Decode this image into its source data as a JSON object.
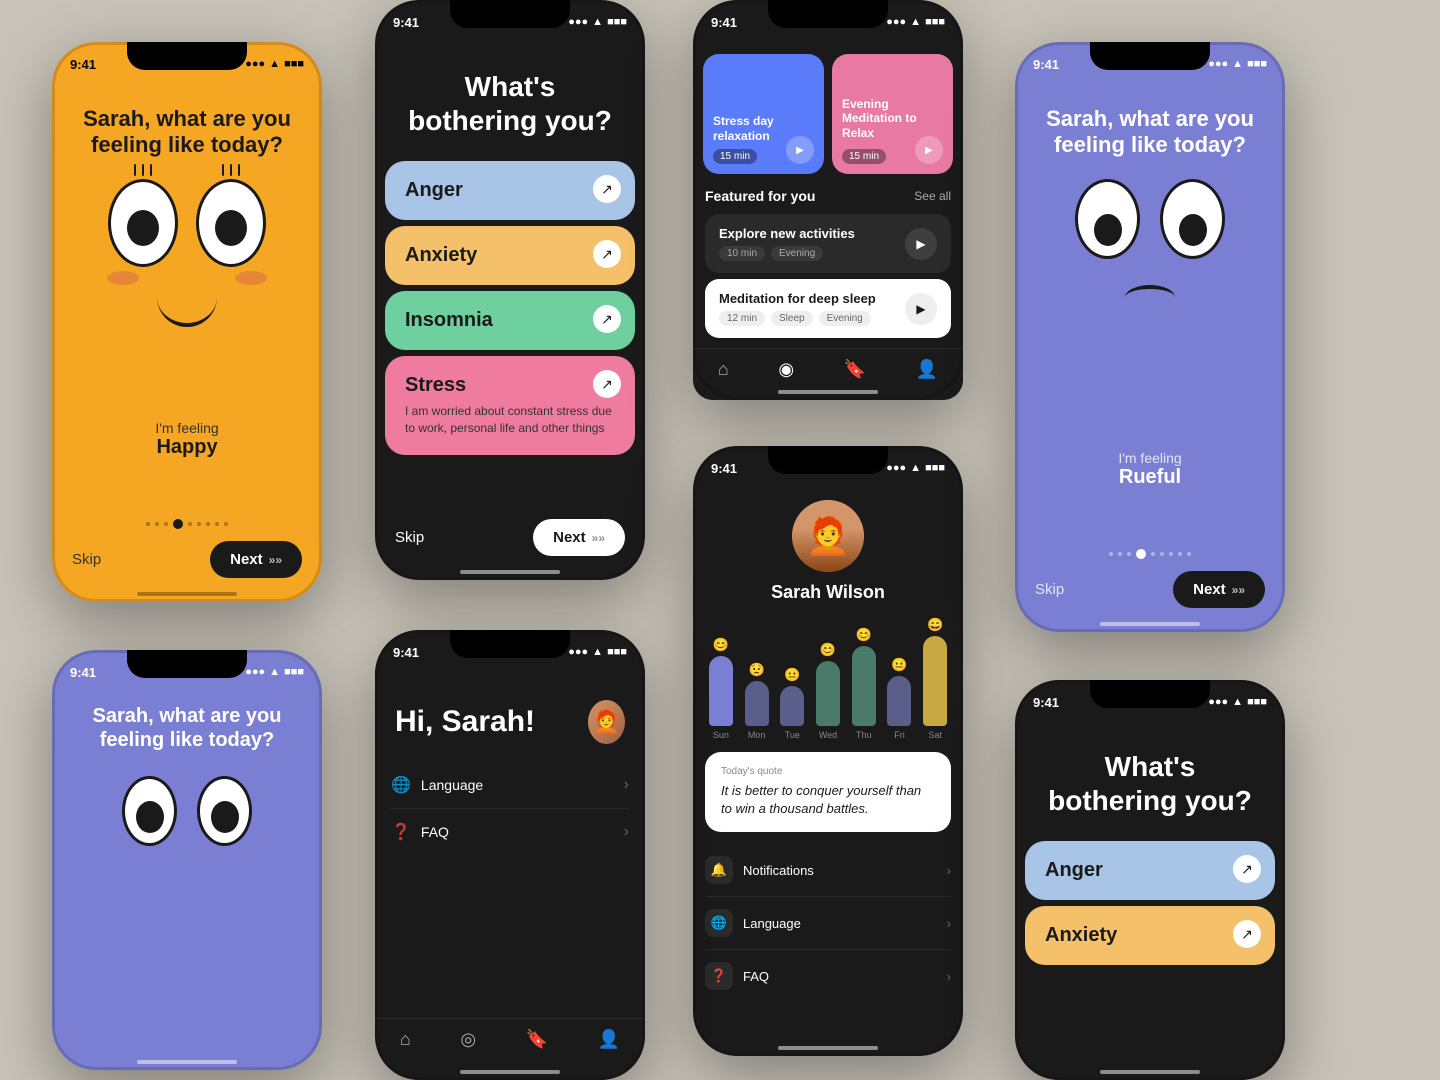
{
  "bg_color": "#c8c3b8",
  "phones": {
    "phone1": {
      "time": "9:41",
      "question": "Sarah, what are you feeling like today?",
      "im_feeling": "I'm feeling",
      "feeling": "Happy",
      "skip": "Skip",
      "next": "Next"
    },
    "phone2": {
      "time": "9:41",
      "title": "What's bothering you?",
      "emotions": [
        {
          "name": "Anger",
          "color": "#a8c5e8"
        },
        {
          "name": "Anxiety",
          "color": "#f5c06a"
        },
        {
          "name": "Insomnia",
          "color": "#6ecf9f"
        },
        {
          "name": "Stress",
          "desc": "I am worried about constant stress due to work, personal life and other things",
          "color": "#f07ba0"
        }
      ],
      "skip": "Skip",
      "next": "Next"
    },
    "phone3": {
      "time": "9:41",
      "cards": [
        {
          "title": "Stress day relaxation",
          "duration": "15 min"
        },
        {
          "title": "Evening Meditation to Relax",
          "duration": "15 min"
        }
      ],
      "featured_label": "Featured for you",
      "see_all": "See all",
      "activities": [
        {
          "name": "Explore new activities",
          "tags": [
            "10 min",
            "Evening"
          ]
        },
        {
          "name": "Meditation for deep sleep",
          "tags": [
            "12 min",
            "Sleep",
            "Evening"
          ]
        }
      ]
    },
    "phone4": {
      "time": "9:41",
      "name": "Sarah Wilson",
      "days": [
        "Sun",
        "Mon",
        "Tue",
        "Wed",
        "Thu",
        "Fri",
        "Sat"
      ],
      "quote_label": "Today's quote",
      "quote": "It is better to conquer yourself than to win a thousand battles.",
      "settings": [
        {
          "label": "Notifications",
          "icon": "🔔"
        },
        {
          "label": "Language",
          "icon": "🌐"
        },
        {
          "label": "FAQ",
          "icon": "❓"
        }
      ]
    },
    "phone5": {
      "time": "9:41",
      "question": "Sarah, what are you feeling like today?",
      "im_feeling": "I'm feeling",
      "feeling": "Rueful",
      "skip": "Skip",
      "next": "Next"
    },
    "phone6": {
      "time": "9:41",
      "title": "What's bothering you?",
      "emotions": [
        {
          "name": "Anger",
          "color": "#a8c5e8"
        },
        {
          "name": "Anxiety",
          "color": "#f5c06a"
        }
      ]
    },
    "phone7": {
      "time": "9:41",
      "question": "Sarah, what are you feeling like today?"
    },
    "phone8": {
      "time": "9:41",
      "greeting": "Hi, Sarah!",
      "settings": [
        {
          "label": "Language",
          "icon": "🌐"
        },
        {
          "label": "FAQ",
          "icon": "❓"
        }
      ]
    }
  }
}
